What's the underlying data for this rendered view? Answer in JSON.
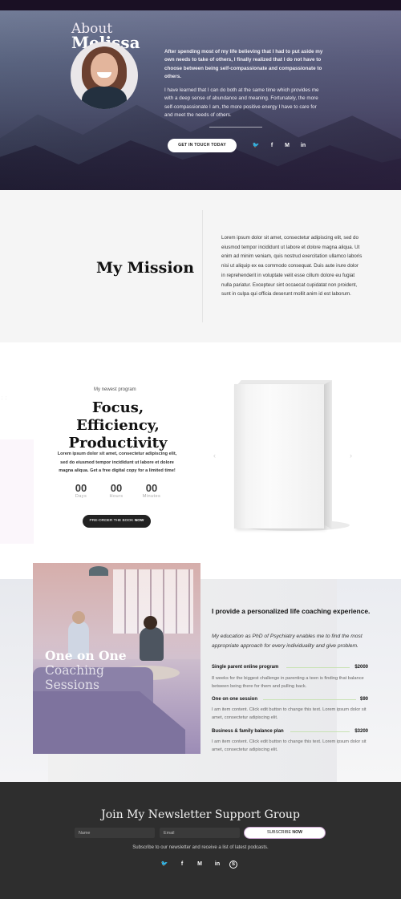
{
  "hero": {
    "about_label": "About",
    "name": "Melissa",
    "paragraph_1": "After spending most of my life believing that I had to put aside my own needs to take of others, I finally realized that I do not have to choose between being self-compassionate and compassionate to others.",
    "paragraph_2": "I have learned that I can do both at the same time which provides me with a deep sense of abundance and meaning. Fortunately, the more self-compassionate I am, the more positive energy I have to care for and meet the needs of others.",
    "cta_label": "GET IN TOUCH TODAY",
    "social": [
      "twitter-icon",
      "facebook-icon",
      "medium-icon",
      "linkedin-icon"
    ],
    "social_glyphs": {
      "twitter": "🐦",
      "facebook": "f",
      "medium": "M",
      "linkedin": "in"
    }
  },
  "mission": {
    "title": "My Mission",
    "text": "Lorem ipsum dolor sit amet, consectetur adipiscing elit, sed do eiusmod tempor incididunt ut labore et dolore magna aliqua. Ut enim ad minim veniam, quis nostrud exercitation ullamco laboris nisi ut aliquip ex ea commodo consequat. Duis aute irure dolor in reprehenderit in voluptate velit esse cillum dolore eu fugiat nulla pariatur. Excepteur sint occaecat cupidatat non proident, sunt in culpa qui officia deserunt mollit anim id est laborum."
  },
  "book": {
    "eyebrow": "My newest program",
    "title": "Focus, Efficiency, Productivity",
    "text": "Lorem ipsum dolor sit amet, consectetur adipiscing elit, sed do eiusmod tempor incididunt ut labore et dolore magna aliqua. Get a free digital copy for a limited time!",
    "countdown": [
      {
        "value": "00",
        "label": "Days"
      },
      {
        "value": "00",
        "label": "Hours"
      },
      {
        "value": "00",
        "label": "Minutes"
      }
    ],
    "cta_prefix": "PRE-ORDER THE BOOK",
    "cta_bold": "NOW",
    "prev_arrow": "‹",
    "next_arrow": "›"
  },
  "coaching": {
    "title_bold": "One on One",
    "title_light": "Coaching",
    "title_line2": "Sessions",
    "heading": "I provide a personalized life coaching experience.",
    "intro": "My education as PhD of Psychiatry enables me to find the most appropriate approach for every individuality and give problem.",
    "services": [
      {
        "name": "Single parent online program",
        "price": "$2000",
        "desc": "8 weeks for the biggest challenge in parenting a teen is finding that balance between being there for them and pulling back."
      },
      {
        "name": "One on one session",
        "price": "$90",
        "desc": "I am item content. Click edit button to change this text. Lorem ipsum dolor sit amet, consectetur adipiscing elit."
      },
      {
        "name": "Business & family balance plan",
        "price": "$3200",
        "desc": "I am item content. Click edit button to change this text. Lorem ipsum dolor sit amet, consectetur adipiscing elit."
      }
    ]
  },
  "newsletter": {
    "title": "Join My Newsletter Support Group",
    "name_placeholder": "Name",
    "email_placeholder": "Email",
    "button_prefix": "SUBSCRIBE",
    "button_bold": "NOW",
    "note": "Subscribe to our newsletter and receive a list of latest podcasts.",
    "social": [
      "twitter-icon",
      "facebook-icon",
      "medium-icon",
      "linkedin-icon",
      "skype-icon"
    ],
    "social_glyphs": {
      "twitter": "🐦",
      "facebook": "f",
      "medium": "M",
      "linkedin": "in",
      "skype": "S"
    }
  },
  "colors": {
    "dark": "#2e2e2e",
    "accent_line": "#c8e2b3",
    "button_border": "#c9a3cf"
  }
}
